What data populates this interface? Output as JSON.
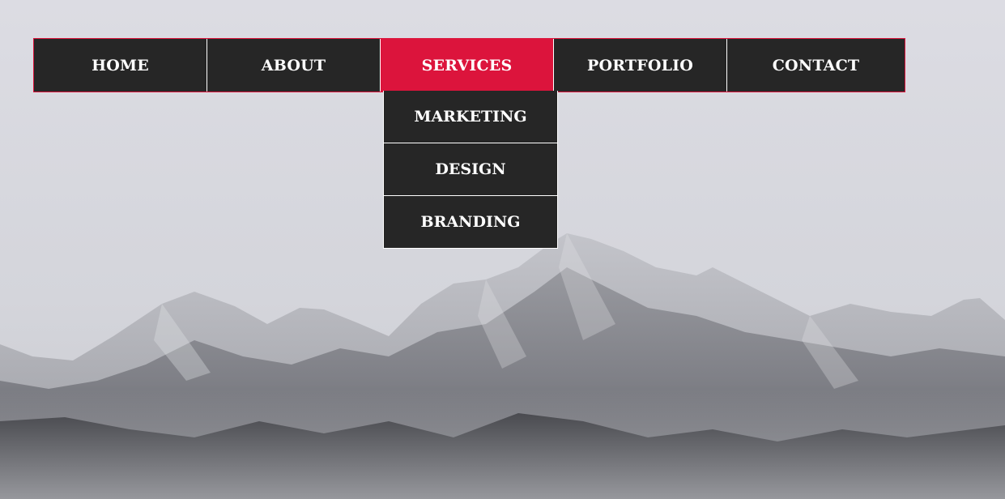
{
  "nav": {
    "items": [
      {
        "label": "HOME"
      },
      {
        "label": "ABOUT"
      },
      {
        "label": "SERVICES"
      },
      {
        "label": "PORTFOLIO"
      },
      {
        "label": "CONTACT"
      }
    ],
    "active": "SERVICES",
    "dropdown": [
      {
        "label": "MARKETING"
      },
      {
        "label": "DESIGN"
      },
      {
        "label": "BRANDING"
      }
    ]
  },
  "colors": {
    "nav_background": "#262626",
    "accent": "#dc143c",
    "text": "#ffffff",
    "sky": "#dcdce2"
  }
}
